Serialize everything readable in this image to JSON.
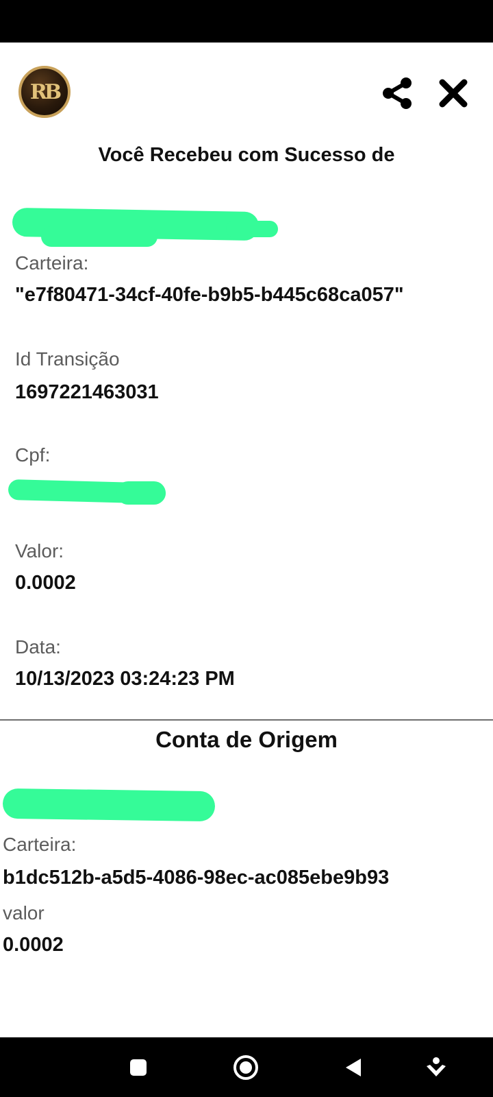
{
  "header": {
    "logo_text": "RB",
    "share_icon": "share-icon",
    "close_icon": "close-icon"
  },
  "title": "Você Recebeu com Sucesso de",
  "sender": {
    "wallet_label": "Carteira:",
    "wallet_value": "\"e7f80471-34cf-40fe-b9b5-b445c68ca057\"",
    "transaction_label": "Id Transição",
    "transaction_value": "1697221463031",
    "cpf_label": "Cpf:",
    "value_label": "Valor:",
    "value_value": "0.0002",
    "date_label": "Data:",
    "date_value": "10/13/2023 03:24:23 PM"
  },
  "origin": {
    "title": "Conta de Origem",
    "wallet_label": "Carteira:",
    "wallet_value": "b1dc512b-a5d5-4086-98ec-ac085ebe9b93",
    "value_label": "valor",
    "value_value": "0.0002"
  },
  "colors": {
    "redaction": "#35fb98",
    "logo_gold": "#c8a15a"
  },
  "nav": {
    "recent_icon": "recent-apps-icon",
    "home_icon": "home-icon",
    "back_icon": "back-icon",
    "assist_icon": "assist-icon"
  }
}
